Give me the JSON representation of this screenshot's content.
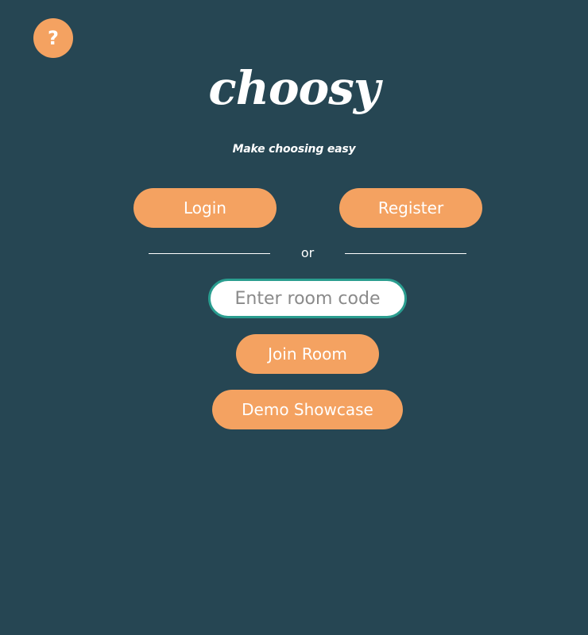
{
  "help": {
    "icon": "question-mark-icon",
    "glyph": "?"
  },
  "brand": {
    "logo": "choosy",
    "tagline": "Make choosing easy"
  },
  "auth": {
    "login_label": "Login",
    "register_label": "Register"
  },
  "divider": {
    "text": "or"
  },
  "room": {
    "placeholder": "Enter room code",
    "value": ""
  },
  "actions": {
    "join_label": "Join Room",
    "demo_label": "Demo Showcase"
  },
  "colors": {
    "background": "#264653",
    "accent": "#f4a261",
    "input_border": "#2a9d8f",
    "text": "#ffffff"
  }
}
